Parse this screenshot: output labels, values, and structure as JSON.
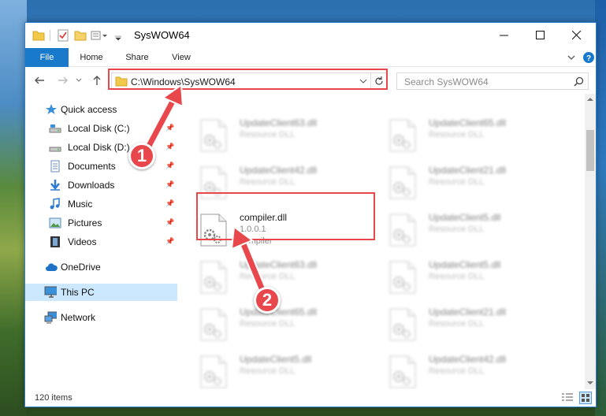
{
  "window": {
    "title": "SysWOW64",
    "ribbon_tabs": [
      "File",
      "Home",
      "Share",
      "View"
    ]
  },
  "address": {
    "path": "C:\\Windows\\SysWOW64",
    "search_placeholder": "Search SysWOW64"
  },
  "nav": {
    "items": [
      {
        "label": "Quick access",
        "icon": "star-icon"
      },
      {
        "label": "Local Disk (C:)",
        "icon": "drive-icon"
      },
      {
        "label": "Local Disk (D:)",
        "icon": "drive-icon"
      },
      {
        "label": "Documents",
        "icon": "documents-icon"
      },
      {
        "label": "Downloads",
        "icon": "download-icon"
      },
      {
        "label": "Music",
        "icon": "music-icon"
      },
      {
        "label": "Pictures",
        "icon": "pictures-icon"
      },
      {
        "label": "Videos",
        "icon": "videos-icon"
      },
      {
        "label": "OneDrive",
        "icon": "cloud-icon"
      },
      {
        "label": "This PC",
        "icon": "computer-icon"
      },
      {
        "label": "Network",
        "icon": "network-icon"
      }
    ]
  },
  "files": [
    {
      "name": "UpdateClient63.dll",
      "line2": "Resource DLL",
      "line3": ""
    },
    {
      "name": "UpdateClient65.dll",
      "line2": "Resource DLL",
      "line3": ""
    },
    {
      "name": "UpdateClient42.dll",
      "line2": "Resource DLL",
      "line3": ""
    },
    {
      "name": "UpdateClient21.dll",
      "line2": "Resource DLL",
      "line3": ""
    },
    {
      "name": "compiler.dll",
      "line2": "1.0.0.1",
      "line3": "compiler"
    },
    {
      "name": "UpdateClient5.dll",
      "line2": "Resource DLL",
      "line3": ""
    },
    {
      "name": "UpdateClient63.dll",
      "line2": "Resource DLL",
      "line3": ""
    },
    {
      "name": "UpdateClient5.dll",
      "line2": "Resource DLL",
      "line3": ""
    },
    {
      "name": "UpdateClient65.dll",
      "line2": "Resource DLL",
      "line3": ""
    },
    {
      "name": "UpdateClient21.dll",
      "line2": "Resource DLL",
      "line3": ""
    },
    {
      "name": "UpdateClient5.dll",
      "line2": "Resource DLL",
      "line3": ""
    },
    {
      "name": "UpdateClient42.dll",
      "line2": "Resource DLL",
      "line3": ""
    }
  ],
  "status": {
    "items_count": "120 items"
  },
  "callouts": {
    "step1": "1",
    "step2": "2"
  },
  "colors": {
    "accent": "#1979ca",
    "callout": "#e8474c",
    "selected": "#cce8ff"
  }
}
